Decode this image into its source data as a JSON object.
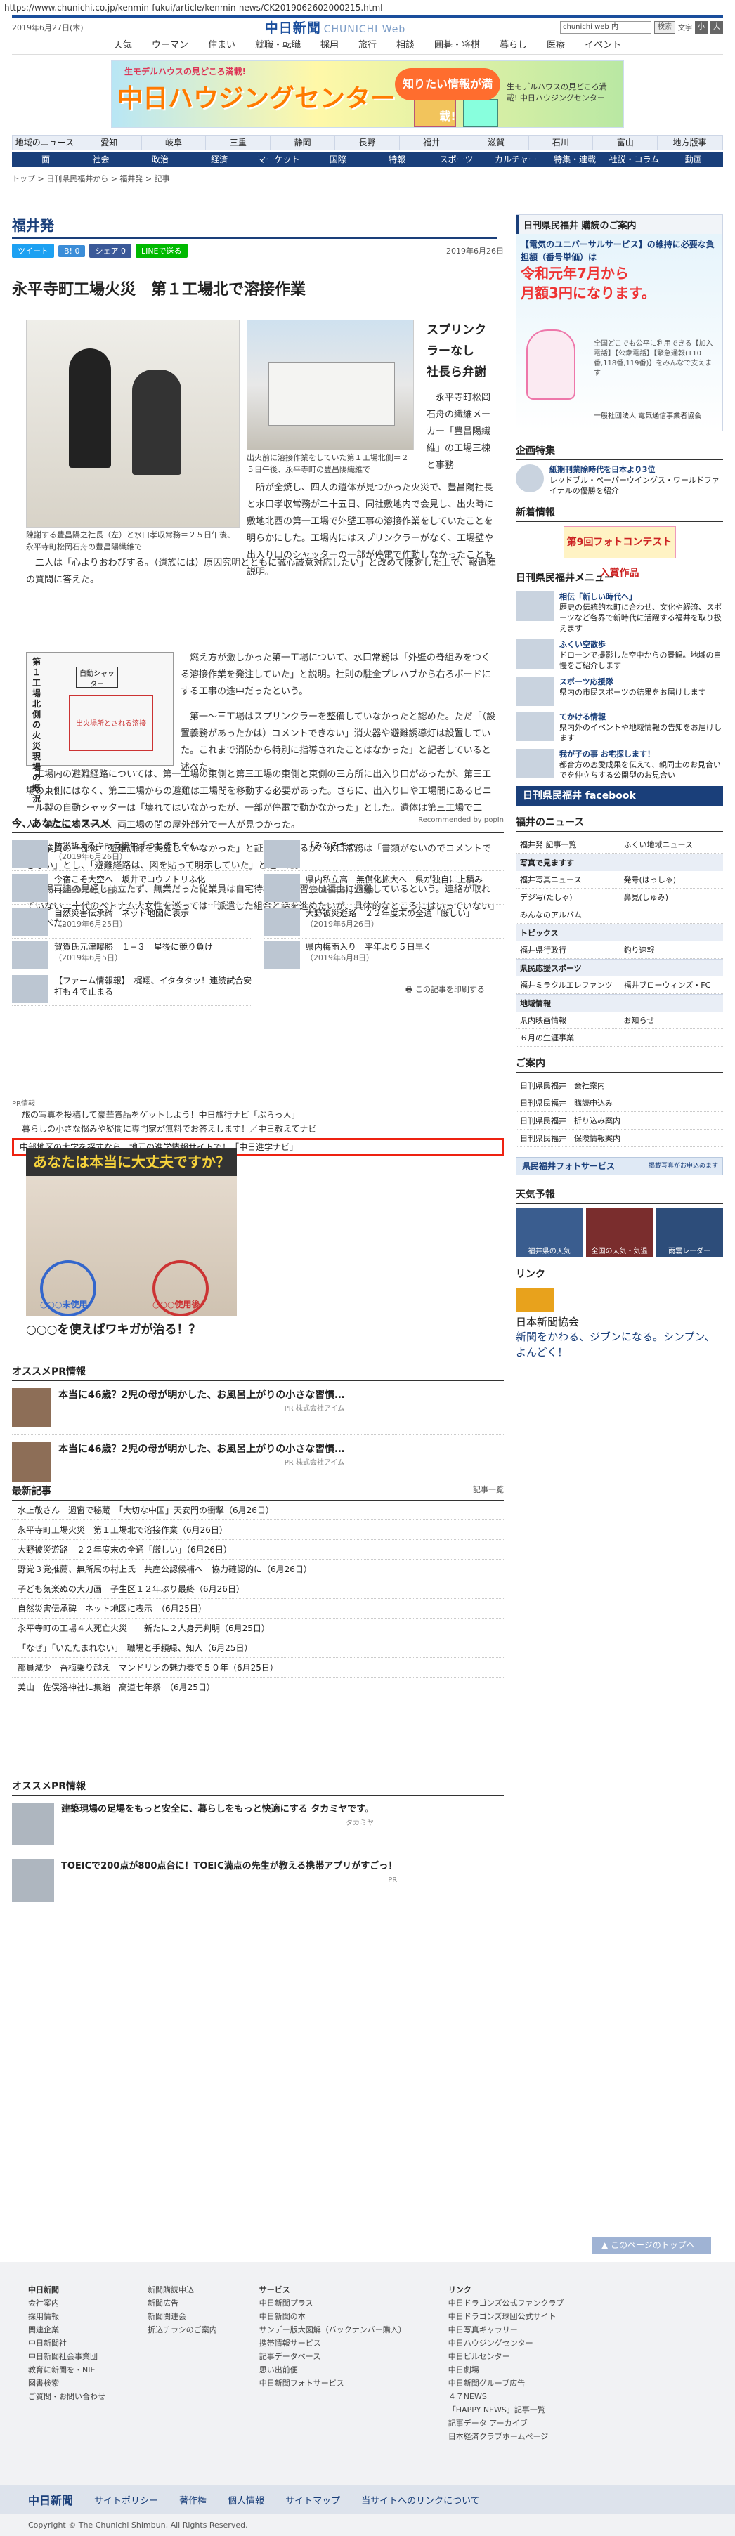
{
  "url": "https://www.chunichi.co.jp/kenmin-fukui/article/kenmin-news/CK2019062602000215.html",
  "header": {
    "date": "2019年6月27日(木)",
    "logo": "中日新聞",
    "logo_sub": "CHUNICHI Web",
    "search_placeholder": "chunichi web 内",
    "search_button": "検索",
    "font_label": "文字",
    "font_small": "小",
    "font_large": "大",
    "nav": [
      "天気",
      "ウーマン",
      "住まい",
      "就職・転職",
      "採用",
      "旅行",
      "相談",
      "囲碁・将棋",
      "暮らし",
      "医療",
      "イベント"
    ]
  },
  "banner": {
    "t1": "生モデルハウスの見どころ満載!",
    "t2": "中日ハウジングセンター",
    "t3": "中日ハウジングセンター",
    "bubble": "知りたい情報が満載!",
    "t4": "生モデルハウスの見どころ満載! 中日ハウジングセンター"
  },
  "region_nav": [
    "地域のニュース",
    "愛知",
    "岐阜",
    "三重",
    "静岡",
    "長野",
    "福井",
    "滋賀",
    "石川",
    "富山",
    "地方版事"
  ],
  "category_nav": [
    "一面",
    "社会",
    "政治",
    "経済",
    "マーケット",
    "国際",
    "特報",
    "スポーツ",
    "カルチャー",
    "特集・連載",
    "社説・コラム",
    "動画"
  ],
  "breadcrumb": "トップ > 日刊県民福井から > 福井発 > 記事",
  "section": "福井発",
  "share": {
    "tweet": "ツイート",
    "b": "B! 0",
    "fb": "シェア 0",
    "line": "LINEで送る",
    "date": "2019年6月26日"
  },
  "article": {
    "title": "永平寺町工場火災　第１工場北で溶接作業",
    "kicker": "スプリンクラーなし　社長ら弁謝",
    "caption1": "陳謝する豊昌陽之社長（左）と水口孝収常務＝２５日午後、永平寺町松岡石舟の豊昌陽繊維で",
    "caption2": "出火前に溶接作業をしていた第１工場北側＝２５日午後、永平寺町の豊昌陽繊維で",
    "p_top": "永平寺町松岡石舟の繊維メーカー「豊昌陽繊維」の工場三棟と事務",
    "p_mid": "所が全焼し、四人の遺体が見つかった火災で、豊昌陽社長と水口孝収常務が二十五日、同社敷地内で会見し、出火時に敷地北西の第一工場で外壁工事の溶接作業をしていたことを明らかにした。工場内にはスプリンクラーがなく、工場壁や出入り口のシャッターの一部が停電で作動しなかったことも説明。",
    "p1": "二人は「心よりおわびする。（遺族には）原因究明とともに誠心誠意対応したい」と改めて陳謝した上で、報道陣の質問に答えた。",
    "map_label": "第１工場北側の火災現場の概況",
    "map_r1": "自動シャッター",
    "map_r2": "出火場所とされる溶接",
    "p2": "燃え方が激しかった第一工場について、水口常務は「外壁の脊組みをつくる溶接作業を発注していた」と説明。社則の駐全プレハブから右ろボードにする工事の途中だったという。",
    "p3": "第一〜三工場はスプリンクラーを整備していなかったと認めた。ただ「（設置義務があったかは）コメントできない」消火器や避難誘導灯は設置していた。これまで消防から特別に指導されたことはなかった」と記者していると述べた。",
    "p4": "工場内の避難経路については、第一工場の東側と第三工場の東側と東側の三方所に出入り口があったが、第三工場の東側にはなく、第二工場からの避難は工場間を移動する必要があった。さらに、出入り口や工場間にあるビニール製の自動シャッターは「壊れてはいなかったが、一部が停電で動かなかった」とした。遺体は第三工場で二人、第二工場で一人、両工場の間の屋外部分で一人が見つかった。",
    "p5": "従業員の一部は「避難訓練を実施していなかった」と証言しているが、水口常務は「書類がないのでコメントできない」とし、「避難経路は、図を貼って明示していた」と述べた。",
    "p6": "工場再建の見通しは立たず、無業だった従業員は自宅待機し、実習生は福由に避難しているという。連絡が取れていない二十代のベトナム人女性を巡っては「派遣した組合と話を進めたいが、具体的なところにはいっていない」と述べた。",
    "print": "この記事を印刷する"
  },
  "ossume": {
    "title": "今、あなたにオススメ",
    "rec_by": "Recommended by popIn",
    "items": [
      {
        "t": "防災訴えるキャラ誕生「つねきちくん」",
        "d": "（2019年6月26日）"
      },
      {
        "t": "「みなみちゃ",
        "d": ""
      },
      {
        "t": "今宿こそ大空へ　坂井でコウノトリふ化",
        "d": "（2019年6月4日）"
      },
      {
        "t": "県内私立高　無償化拡大へ　県が独自に上積み",
        "d": "（2019年6月13日）"
      },
      {
        "t": "自然災害伝承碑　ネット地図に表示",
        "d": "（2019年6月25日）"
      },
      {
        "t": "大野被災遊路　２２年度末の全通「厳しい」",
        "d": "（2019年6月26日）"
      },
      {
        "t": "賀賀氏元津曝勝　１−３　星後に競り負け",
        "d": "（2019年6月5日）"
      },
      {
        "t": "県内梅雨入り　平年より５日早く",
        "d": "（2019年6月8日）"
      },
      {
        "t": "【ファーム情報報】　梶翔、イタタタッ！連続試合安打も４で止まる",
        "d": ""
      }
    ]
  },
  "pr": {
    "label": "PR情報",
    "items": [
      "旅の写真を投稿して豪華賞品をゲットしよう！中日旅行ナビ「ぶらっ人」",
      "暮らしの小さな悩みや疑問に専門家が無料でお答えします！／中日教えてナビ"
    ],
    "highlight": "中部地区の大学を探すなら、地元の進学情報サイトで！「中日進学ナビ」"
  },
  "ad": {
    "head": "あなたは本当に大丈夫ですか？",
    "l1": "○○○未使用",
    "l2": "○○○使用後",
    "caption": "○○○を使えばワキガが治る！？"
  },
  "ossume_pr": {
    "title": "オススメPR情報",
    "items": [
      {
        "t": "本当に46歳？2児の母が明かした、お風呂上がりの小さな習慣…",
        "pr": "PR 株式会社アイム"
      },
      {
        "t": "本当に46歳？2児の母が明かした、お風呂上がりの小さな習慣…",
        "pr": "PR 株式会社アイム"
      }
    ]
  },
  "recent": {
    "title": "最新記事",
    "more": "記事一覧",
    "items": [
      "水上敬さん　週窗で秘蔵　「大切な中国」天安門の衝撃（6月26日）",
      "永平寺町工場火災　第１工場北で溶接作業（6月26日）",
      "大野被災遊路　２２年度末の全通「厳しい」（6月26日）",
      "野党３党推薦、無所属の村上氏　共産公認候補へ　協力確認的に（6月26日）",
      "子ども気楽ぬの大刀画　子生区１２年ぶり最終（6月26日）",
      "自然災害伝承碑　ネット地図に表示　（6月25日）",
      "永平寺町の工場４人死亡火災　　新たに２人身元判明（6月25日）",
      "「なぜ」「いたたまれない」　職場と手頼緑、知人（6月25日）",
      "部員減少　吾梅乗り越え　マンドリンの魅力奏で５０年（6月25日）",
      "美山　佐俣浴神社に集踏　高道七年祭　（6月25日）"
    ]
  },
  "ossume_pr2": {
    "title": "オススメPR情報",
    "items": [
      {
        "t": "建築現場の足場をもっと安全に、暮らしをもっと快適にする タカミヤです。",
        "pr": "タカミヤ"
      },
      {
        "t": "TOEICで200点が800点台に！TOEIC満点の先生が教える携帯アプリがすごっ！",
        "pr": "PR"
      }
    ]
  },
  "side": {
    "koudoku": "日刊県民福井 購読のご案内",
    "ad_l1": "【電気のユニバーサルサービス】の維持に必要な負担額（番号単価）は",
    "ad_l2": "令和元年7月から",
    "ad_l3": "月額3円になります。",
    "ad_small": "全国どこでも公平に利用できる【加入電話】【公衆電話】【緊急通報(110番,118番,119番)】をみんなで支えます",
    "ad_org": "一般社団法人 電気通信事業者協会",
    "kikaku_title": "企画特集",
    "kikaku_item_t": "紙期刊業除時代を日本より3位",
    "kikaku_item_d": "レッドブル・ペーパーウイングス・ワールドファイナルの優勝を紹介",
    "shinsaku_title": "新着情報",
    "shinsaku_banner": "第9回フォトコンテスト 入賞作品",
    "menu_title": "日刊県民福井メニュー",
    "menu": [
      {
        "t": "相伝「新しい時代へ」",
        "d": "歴史の伝統的な町に合わせ、文化や経済、スポーツなど各界で新時代に活躍する福井を取り扱えます"
      },
      {
        "t": "ふくい空散歩",
        "d": "ドローンで撮影した空中からの景観。地域の自慢をご紹介します"
      },
      {
        "t": "スポーツ応援隊",
        "d": "県内の市民スポーツの結果をお届けします"
      },
      {
        "t": "てかける情報",
        "d": "県内外のイベントや地域情報の告知をお届けします"
      },
      {
        "t": "我が子の事 お宅探します！",
        "d": "都合方の恋愛成果を伝えて、親同士のお見合いでを仲立ちする公開型のお見合い"
      }
    ],
    "fb": "日刊県民福井 facebook",
    "fnews_title": "福井のニュース",
    "fnews": [
      [
        "福井発 記事一覧",
        "ふくい地域ニュース"
      ],
      [
        "写真で見ますす"
      ],
      [
        "福井写真ニュース",
        "発号(はっしゃ)"
      ],
      [
        "デジ写(たしゃ)",
        "鼻見(しゅみ)"
      ],
      [
        "みんなのアルバム"
      ],
      [
        "トピックス"
      ],
      [
        "福井県行政行",
        "釣り速報"
      ],
      [
        "県民応援スポーツ"
      ],
      [
        "福井ミラクルエレファンツ",
        "福井ブローウィンズ・FC"
      ],
      [
        "地域情報"
      ],
      [
        "県内映画情報",
        "お知らせ"
      ],
      [
        "６月の生涯事業"
      ]
    ],
    "guide_title": "ご案内",
    "guide": [
      [
        "日刊県民福井　会社案内"
      ],
      [
        "日刊県民福井　購読申込み"
      ],
      [
        "日刊県民福井　折り込み案内"
      ],
      [
        "日刊県民福井　保険情報案内"
      ]
    ],
    "photo_banner": "県民福井フォトサービス",
    "photo_sub": "掲載写真がお申込めます",
    "tenki_title": "天気予報",
    "tenki": [
      "福井県の天気",
      "全国の天気・気温",
      "雨雲レーダー"
    ],
    "link_title": "リンク",
    "link_name": "日本新聞協会",
    "link_copy": "新聞をかわる、ジブンになる。シンプン、よんどく！"
  },
  "footer": {
    "toplink": "このページのトップへ",
    "cols": [
      {
        "h": "中日新聞",
        "items": [
          "会社案内",
          "採用情報",
          "関連企業",
          "中日新聞社",
          "中日新聞社会事業団",
          "教育に新聞を・NIE",
          "図書検索",
          "ご質問・お問い合わせ"
        ]
      },
      {
        "h": "",
        "items": [
          "新聞購読申込",
          "新聞広告",
          "新聞関連会",
          "折込チラシのご案内"
        ]
      },
      {
        "h": "サービス",
        "items": [
          "中日新聞プラス",
          "中日新聞の本",
          "サンデー版大図解（バックナンバー購入）",
          "携帯情報サービス",
          "記事データベース",
          "思い出前便",
          "中日新聞フォトサービス"
        ]
      },
      {
        "h": "リンク",
        "items": [
          "中日ドラゴンズ公式ファンクラブ",
          "中日ドラゴンズ球団公式サイト",
          "中日写真ギャラリー",
          "中日ハウジングセンター",
          "中日ビルセンター",
          "中日劇場",
          "中日新聞グループ広告",
          "４７NEWS",
          "「HAPPY NEWS」記事一覧",
          "記事データ アーカイブ",
          "日本経済クラブホームページ"
        ]
      }
    ],
    "bar_logo": "中日新聞",
    "bar": [
      "サイトポリシー",
      "著作権",
      "個人情報",
      "サイトマップ",
      "当サイトへのリンクについて"
    ],
    "copyright": "Copyright © The Chunichi Shimbun, All Rights Reserved."
  }
}
